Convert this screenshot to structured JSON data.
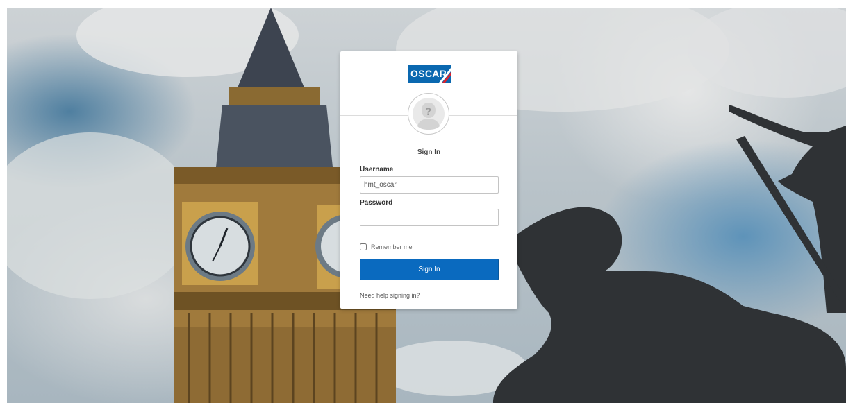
{
  "brand": {
    "logo_text": "OSCAR",
    "colors": {
      "primary": "#0a68b0",
      "accent": "#d9232e"
    }
  },
  "login": {
    "title": "Sign In",
    "username": {
      "label": "Username",
      "value": "hmt_oscar",
      "placeholder": ""
    },
    "password": {
      "label": "Password",
      "value": "",
      "placeholder": ""
    },
    "remember_me": {
      "label": "Remember me",
      "checked": false
    },
    "submit_label": "Sign In",
    "help_link": "Need help signing in?"
  },
  "icons": {
    "avatar": "user-placeholder-icon"
  }
}
